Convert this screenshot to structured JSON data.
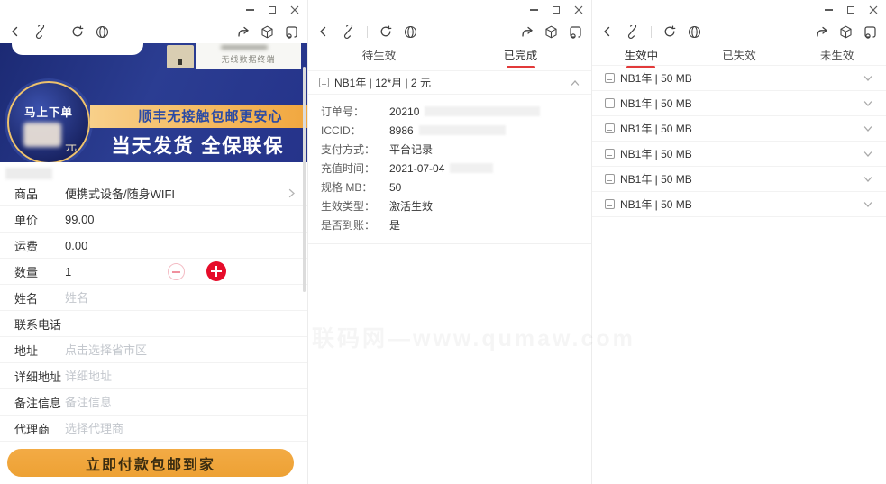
{
  "watermark": "联码网—www.qumaw.com",
  "colors": {
    "banner_blue": "#25338a",
    "ribbon_gold": "#f1a73f",
    "accent_red": "#e60c2a",
    "tab_underline_red": "#e23a3a",
    "pay_button_orange": "#eda134"
  },
  "left_window": {
    "product_card_label": "无线数据终端",
    "banner": {
      "badge_text": "马上下单",
      "badge_unit": "元",
      "ribbon_text": "顺丰无接触包邮更安心",
      "headline": "当天发货 全保联保"
    },
    "form": {
      "product": {
        "label": "商品",
        "value": "便携式设备/随身WIFI"
      },
      "price": {
        "label": "单价",
        "value": "99.00"
      },
      "shipping": {
        "label": "运费",
        "value": "0.00"
      },
      "quantity": {
        "label": "数量",
        "value": "1"
      },
      "name": {
        "label": "姓名",
        "placeholder": "姓名"
      },
      "phone": {
        "label": "联系电话",
        "placeholder": ""
      },
      "address": {
        "label": "地址",
        "placeholder": "点击选择省市区"
      },
      "address_detail": {
        "label": "详细地址",
        "placeholder": "详细地址"
      },
      "remark": {
        "label": "备注信息",
        "placeholder": "备注信息"
      },
      "agent": {
        "label": "代理商",
        "placeholder": "选择代理商"
      }
    },
    "pay_button": "立即付款包邮到家"
  },
  "middle_window": {
    "tabs": {
      "pending": "待生效",
      "completed": "已完成"
    },
    "order": {
      "title": "NB1年 | 12*月 | 2 元",
      "details": {
        "order_no": {
          "label": "订单号：",
          "value": "20210"
        },
        "iccid": {
          "label": "ICCID：",
          "value": "8986"
        },
        "pay_method": {
          "label": "支付方式：",
          "value": "平台记录"
        },
        "recharge_time": {
          "label": "充值时间：",
          "value": "2021-07-04"
        },
        "spec": {
          "label": "规格 MB：",
          "value": "50"
        },
        "effect_type": {
          "label": "生效类型：",
          "value": "激活生效"
        },
        "received": {
          "label": "是否到账：",
          "value": "是"
        }
      }
    }
  },
  "right_window": {
    "tabs": {
      "active": "生效中",
      "expired": "已失效",
      "inactive": "未生效"
    },
    "items": [
      {
        "title": "NB1年 | 50 MB"
      },
      {
        "title": "NB1年 | 50 MB"
      },
      {
        "title": "NB1年 | 50 MB"
      },
      {
        "title": "NB1年 | 50 MB"
      },
      {
        "title": "NB1年 | 50 MB"
      },
      {
        "title": "NB1年 | 50 MB"
      }
    ]
  }
}
